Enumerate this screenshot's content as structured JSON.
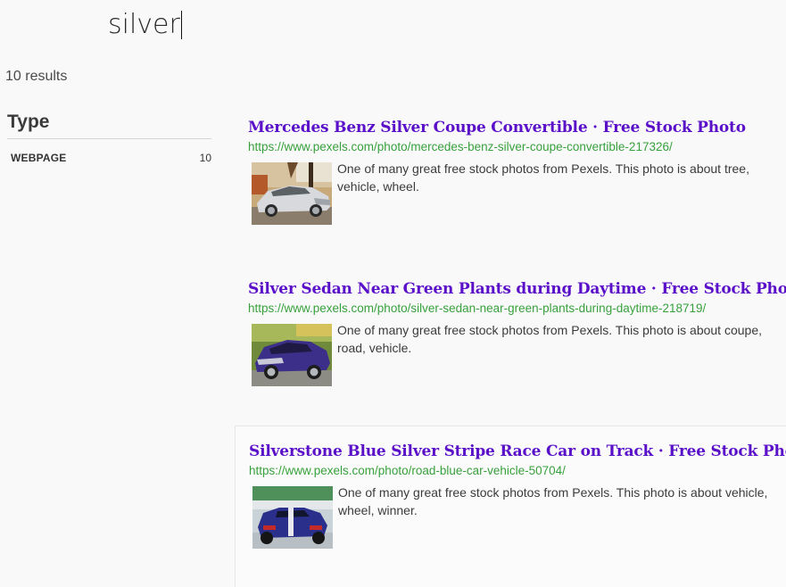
{
  "search": {
    "query": "silver"
  },
  "summary": {
    "count_text": "10 results"
  },
  "facets": {
    "title": "Type",
    "items": [
      {
        "label": "WEBPAGE",
        "count": "10"
      }
    ]
  },
  "results": [
    {
      "title": "Mercedes Benz Silver Coupe Convertible · Free Stock Photo",
      "url": "https://www.pexels.com/photo/mercedes-benz-silver-coupe-convertible-217326/",
      "snippet": "One of many great free stock photos from Pexels. This photo is about tree, vehicle, wheel."
    },
    {
      "title": "Silver Sedan Near Green Plants during Daytime · Free Stock Photo",
      "url": "https://www.pexels.com/photo/silver-sedan-near-green-plants-during-daytime-218719/",
      "snippet": "One of many great free stock photos from Pexels. This photo is about coupe, road, vehicle."
    },
    {
      "title": "Silverstone Blue Silver Stripe Race Car on Track · Free Stock Photo",
      "url": "https://www.pexels.com/photo/road-blue-car-vehicle-50704/",
      "snippet": "One of many great free stock photos from Pexels. This photo is about vehicle, wheel, winner."
    }
  ],
  "colors": {
    "title_link": "#5a0fc8",
    "url_green": "#38a13c"
  }
}
